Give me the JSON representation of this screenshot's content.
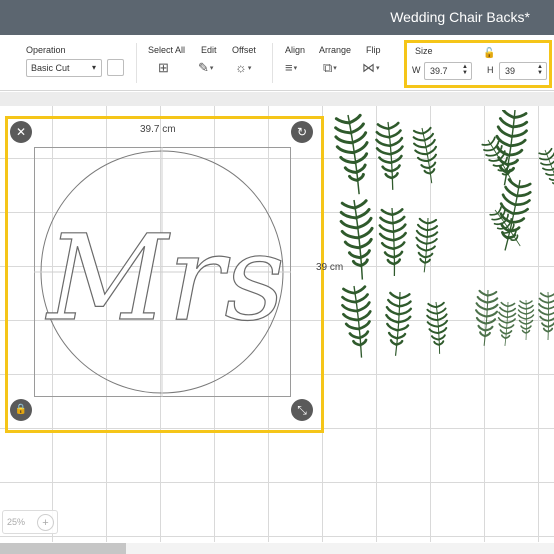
{
  "window": {
    "title": "Wedding Chair Backs*"
  },
  "toolbar": {
    "operation": {
      "label": "Operation",
      "value": "Basic Cut",
      "caret": "▾"
    },
    "select_all": {
      "label": "Select All",
      "icon": "select-all-icon",
      "glyph": "⊞"
    },
    "edit": {
      "label": "Edit",
      "icon": "edit-icon",
      "glyph": "✎"
    },
    "offset": {
      "label": "Offset",
      "icon": "offset-icon",
      "glyph": "☼"
    },
    "align": {
      "label": "Align",
      "icon": "align-icon",
      "glyph": "≡"
    },
    "arrange": {
      "label": "Arrange",
      "icon": "arrange-icon",
      "glyph": "⧉"
    },
    "flip": {
      "label": "Flip",
      "icon": "flip-icon",
      "glyph": "⋈"
    },
    "dropdown_glyph": "▾",
    "size": {
      "label": "Size",
      "lock_glyph": "🔓",
      "w_label": "W",
      "w_value": "39.7",
      "h_label": "H",
      "h_value": "39",
      "spin_glyph": "▲▼"
    }
  },
  "canvas": {
    "width_label": "39.7 cm",
    "height_label": "39 cm",
    "artwork_text": "Mrs",
    "handles": {
      "delete": "✕",
      "rotate": "↻",
      "lock": "🔒",
      "scale": "⤡"
    }
  },
  "zoom": {
    "value": "25%",
    "plus": "+"
  },
  "colors": {
    "title_bar": "#5c6670",
    "highlight": "#f5c518",
    "fern_dark": "#2f5a2c",
    "fern_light": "#7a8a3a"
  }
}
